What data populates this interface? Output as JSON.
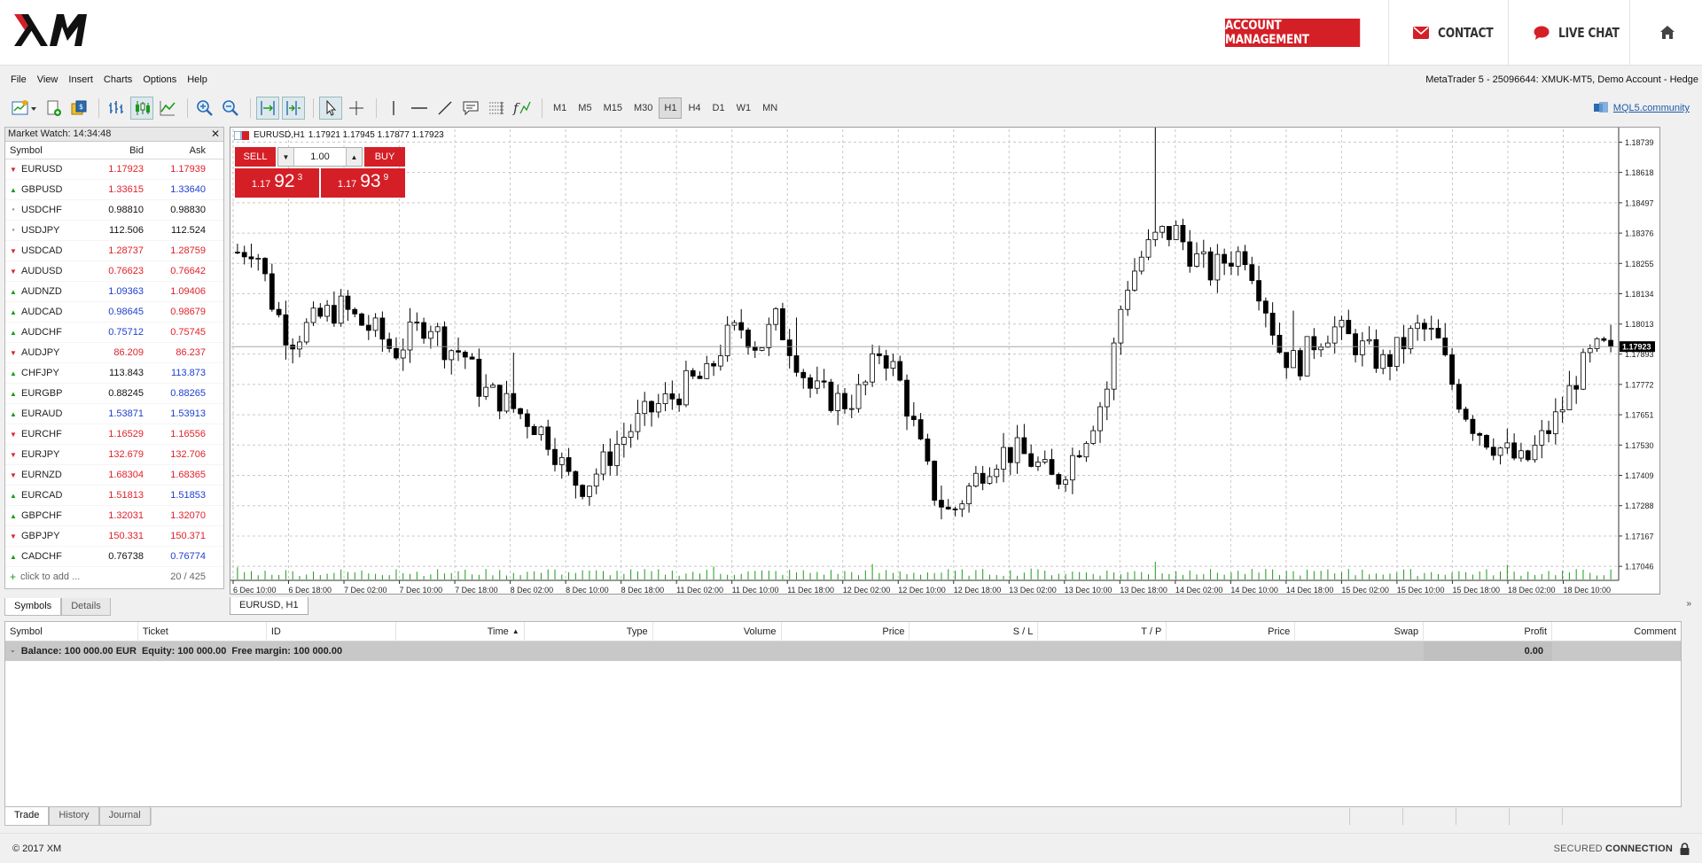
{
  "header": {
    "account_management": "ACCOUNT MANAGEMENT",
    "contact": "CONTACT",
    "live_chat": "LIVE CHAT",
    "brand_color": "#d51f27"
  },
  "menu": {
    "items": [
      "File",
      "View",
      "Insert",
      "Charts",
      "Options",
      "Help"
    ],
    "account_info": "MetaTrader 5 - 25096644: XMUK-MT5, Demo Account - Hedge"
  },
  "toolbar": {
    "timeframes": [
      "M1",
      "M5",
      "M15",
      "M30",
      "H1",
      "H4",
      "D1",
      "W1",
      "MN"
    ],
    "active_timeframe": "H1",
    "mql_link": "MQL5.community"
  },
  "market_watch": {
    "title": "Market Watch: 14:34:48",
    "columns": {
      "symbol": "Symbol",
      "bid": "Bid",
      "ask": "Ask"
    },
    "rows": [
      {
        "symbol": "EURUSD",
        "dir": "down",
        "bid": "1.17923",
        "ask": "1.17939",
        "color": "red"
      },
      {
        "symbol": "GBPUSD",
        "dir": "up",
        "bid": "1.33615",
        "ask": "1.33640",
        "color": "redblue"
      },
      {
        "symbol": "USDCHF",
        "dir": "flat",
        "bid": "0.98810",
        "ask": "0.98830",
        "color": "black"
      },
      {
        "symbol": "USDJPY",
        "dir": "flat",
        "bid": "112.506",
        "ask": "112.524",
        "color": "black"
      },
      {
        "symbol": "USDCAD",
        "dir": "down",
        "bid": "1.28737",
        "ask": "1.28759",
        "color": "red"
      },
      {
        "symbol": "AUDUSD",
        "dir": "down",
        "bid": "0.76623",
        "ask": "0.76642",
        "color": "red"
      },
      {
        "symbol": "AUDNZD",
        "dir": "up",
        "bid": "1.09363",
        "ask": "1.09406",
        "color": "bluered"
      },
      {
        "symbol": "AUDCAD",
        "dir": "up",
        "bid": "0.98645",
        "ask": "0.98679",
        "color": "bluered"
      },
      {
        "symbol": "AUDCHF",
        "dir": "up",
        "bid": "0.75712",
        "ask": "0.75745",
        "color": "bluered"
      },
      {
        "symbol": "AUDJPY",
        "dir": "down",
        "bid": "86.209",
        "ask": "86.237",
        "color": "red"
      },
      {
        "symbol": "CHFJPY",
        "dir": "up",
        "bid": "113.843",
        "ask": "113.873",
        "color": "blackblue"
      },
      {
        "symbol": "EURGBP",
        "dir": "up",
        "bid": "0.88245",
        "ask": "0.88265",
        "color": "blackblue"
      },
      {
        "symbol": "EURAUD",
        "dir": "up",
        "bid": "1.53871",
        "ask": "1.53913",
        "color": "blue"
      },
      {
        "symbol": "EURCHF",
        "dir": "down",
        "bid": "1.16529",
        "ask": "1.16556",
        "color": "red"
      },
      {
        "symbol": "EURJPY",
        "dir": "down",
        "bid": "132.679",
        "ask": "132.706",
        "color": "red"
      },
      {
        "symbol": "EURNZD",
        "dir": "down",
        "bid": "1.68304",
        "ask": "1.68365",
        "color": "red"
      },
      {
        "symbol": "EURCAD",
        "dir": "up",
        "bid": "1.51813",
        "ask": "1.51853",
        "color": "redblue"
      },
      {
        "symbol": "GBPCHF",
        "dir": "up",
        "bid": "1.32031",
        "ask": "1.32070",
        "color": "red"
      },
      {
        "symbol": "GBPJPY",
        "dir": "down",
        "bid": "150.331",
        "ask": "150.371",
        "color": "red"
      },
      {
        "symbol": "CADCHF",
        "dir": "up",
        "bid": "0.76738",
        "ask": "0.76774",
        "color": "blackblue"
      }
    ],
    "add_label": "click to add ...",
    "count": "20 / 425",
    "tabs": [
      "Symbols",
      "Details"
    ]
  },
  "chart": {
    "title": "EURUSD,H1",
    "ohlc": "1.17921 1.17945 1.17877 1.17923",
    "tab_label": "EURUSD, H1",
    "trade": {
      "sell": "SELL",
      "buy": "BUY",
      "lot": "1.00",
      "sell_small": "1.17",
      "sell_big": "92",
      "sell_sup": "3",
      "buy_small": "1.17",
      "buy_big": "93",
      "buy_sup": "9"
    }
  },
  "chart_data": {
    "type": "candlestick",
    "symbol": "EURUSD",
    "timeframe": "H1",
    "current_price": "1.17923",
    "y_ticks": [
      "1.18739",
      "1.18618",
      "1.18497",
      "1.18376",
      "1.18255",
      "1.18134",
      "1.18013",
      "1.17893",
      "1.17772",
      "1.17651",
      "1.17530",
      "1.17409",
      "1.17288",
      "1.17167",
      "1.17046"
    ],
    "x_ticks": [
      "6 Dec 10:00",
      "6 Dec 18:00",
      "7 Dec 02:00",
      "7 Dec 10:00",
      "7 Dec 18:00",
      "8 Dec 02:00",
      "8 Dec 10:00",
      "8 Dec 18:00",
      "11 Dec 02:00",
      "11 Dec 10:00",
      "11 Dec 18:00",
      "12 Dec 02:00",
      "12 Dec 10:00",
      "12 Dec 18:00",
      "13 Dec 02:00",
      "13 Dec 10:00",
      "13 Dec 18:00",
      "14 Dec 02:00",
      "14 Dec 10:00",
      "14 Dec 18:00",
      "15 Dec 02:00",
      "15 Dec 10:00",
      "15 Dec 18:00",
      "18 Dec 02:00",
      "18 Dec 10:00"
    ],
    "ylim": [
      1.1699,
      1.1879
    ],
    "close_path": [
      1.183,
      1.1833,
      1.181,
      1.1795,
      1.18,
      1.1805,
      1.1808,
      1.1802,
      1.1798,
      1.179,
      1.1797,
      1.1803,
      1.1792,
      1.179,
      1.1775,
      1.1772,
      1.1767,
      1.1762,
      1.1755,
      1.174,
      1.1737,
      1.1745,
      1.1755,
      1.1762,
      1.1768,
      1.1772,
      1.1778,
      1.178,
      1.1795,
      1.18,
      1.1792,
      1.1803,
      1.179,
      1.1775,
      1.1772,
      1.177,
      1.1775,
      1.1792,
      1.178,
      1.1758,
      1.1735,
      1.1725,
      1.1735,
      1.1745,
      1.175,
      1.175,
      1.1745,
      1.1738,
      1.1748,
      1.176,
      1.1775,
      1.1815,
      1.1828,
      1.1837,
      1.1838,
      1.1828,
      1.1822,
      1.1828,
      1.183,
      1.1812,
      1.179,
      1.1785,
      1.1795,
      1.18,
      1.1795,
      1.179,
      1.1785,
      1.1793,
      1.18,
      1.1795,
      1.1775,
      1.1762,
      1.1755,
      1.175,
      1.1745,
      1.1755,
      1.1765,
      1.178,
      1.179,
      1.1792
    ],
    "volume_color": "#1a9a1a"
  },
  "terminal": {
    "columns": [
      "Symbol",
      "Ticket",
      "ID",
      "Time",
      "Type",
      "Volume",
      "Price",
      "S / L",
      "T / P",
      "Price",
      "Swap",
      "Profit",
      "Comment"
    ],
    "balance_label": "Balance: 100 000.00 EUR",
    "equity_label": "Equity: 100 000.00",
    "free_margin_label": "Free margin: 100 000.00",
    "profit": "0.00",
    "tabs": [
      "Trade",
      "History",
      "Journal"
    ]
  },
  "footer": {
    "copyright": "© 2017 XM",
    "secured_pre": "SECURED",
    "secured_post": "CONNECTION"
  }
}
